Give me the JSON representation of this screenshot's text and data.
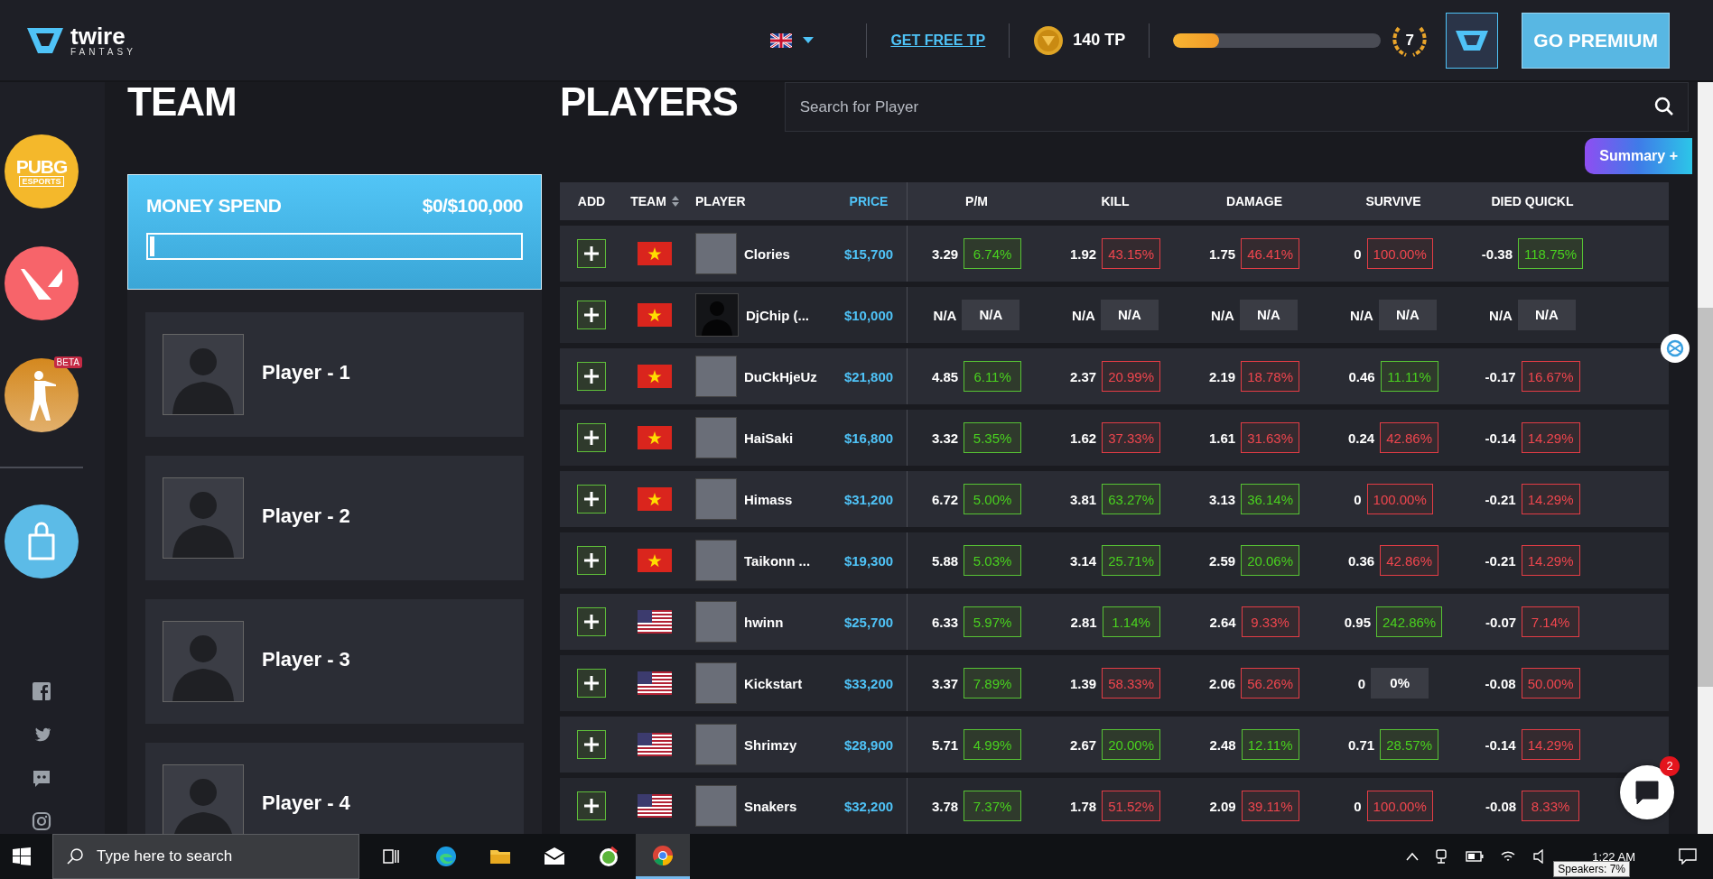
{
  "header": {
    "logo": {
      "name": "twire",
      "sub": "FANTASY"
    },
    "language": {
      "kind": "uk"
    },
    "free_tp_link": "GET FREE TP",
    "balance": "140 TP",
    "xp": {
      "level": 0.22
    },
    "rank": "7",
    "premium_button": "GO PREMIUM"
  },
  "rail": {
    "games": [
      {
        "kind": "pubg",
        "line1": "PUBG",
        "line2": "ESPORTS",
        "selected": false
      },
      {
        "kind": "valorant",
        "selected": false
      },
      {
        "kind": "cs",
        "badge": "BETA",
        "selected": false
      }
    ],
    "social": [
      {
        "kind": "facebook"
      },
      {
        "kind": "twitter"
      },
      {
        "kind": "discord"
      },
      {
        "kind": "instagram"
      }
    ]
  },
  "team": {
    "title": "TEAM",
    "money": {
      "label": "MONEY SPEND",
      "value": "$0/$100,000",
      "level": 0.01
    },
    "slots": [
      "Player - 1",
      "Player - 2",
      "Player - 3",
      "Player - 4"
    ]
  },
  "players": {
    "title": "PLAYERS",
    "search": {
      "placeholder": "Search for Player"
    },
    "summary_button": "Summary +",
    "columns": [
      {
        "label": "ADD",
        "sortable": false,
        "active": false
      },
      {
        "label": "TEAM",
        "sortable": true,
        "active": false
      },
      {
        "label": "PLAYER",
        "sortable": false,
        "active": false
      },
      {
        "label": "PRICE",
        "sortable": false,
        "active": true
      },
      {
        "label": "P/M",
        "sortable": false,
        "active": false
      },
      {
        "label": "KILL",
        "sortable": false,
        "active": false
      },
      {
        "label": "DAMAGE",
        "sortable": false,
        "active": false
      },
      {
        "label": "SURVIVE",
        "sortable": false,
        "active": false
      },
      {
        "label": "DIED QUICKL",
        "sortable": false,
        "active": false
      }
    ],
    "rows": [
      {
        "flag": {
          "kind": "vn"
        },
        "avatar": {
          "kind": "photo"
        },
        "name": "Clories",
        "price": "$15,700",
        "stats": [
          {
            "value": "3.29",
            "pct": "6.74%",
            "kind": "good"
          },
          {
            "value": "1.92",
            "pct": "43.15%",
            "kind": "bad"
          },
          {
            "value": "1.75",
            "pct": "46.41%",
            "kind": "bad"
          },
          {
            "value": "0",
            "pct": "100.00%",
            "kind": "bad"
          },
          {
            "value": "-0.38",
            "pct": "118.75%",
            "kind": "good"
          }
        ]
      },
      {
        "flag": {
          "kind": "vn"
        },
        "avatar": {
          "kind": "silhouette"
        },
        "name": "DjChip (...",
        "price": "$10,000",
        "stats": [
          {
            "value": "N/A",
            "pct": "N/A",
            "kind": "none"
          },
          {
            "value": "N/A",
            "pct": "N/A",
            "kind": "none"
          },
          {
            "value": "N/A",
            "pct": "N/A",
            "kind": "none"
          },
          {
            "value": "N/A",
            "pct": "N/A",
            "kind": "none"
          },
          {
            "value": "N/A",
            "pct": "N/A",
            "kind": "none"
          }
        ]
      },
      {
        "flag": {
          "kind": "vn"
        },
        "avatar": {
          "kind": "photo"
        },
        "name": "DuCkHjeUz",
        "price": "$21,800",
        "stats": [
          {
            "value": "4.85",
            "pct": "6.11%",
            "kind": "good"
          },
          {
            "value": "2.37",
            "pct": "20.99%",
            "kind": "bad"
          },
          {
            "value": "2.19",
            "pct": "18.78%",
            "kind": "bad"
          },
          {
            "value": "0.46",
            "pct": "11.11%",
            "kind": "good"
          },
          {
            "value": "-0.17",
            "pct": "16.67%",
            "kind": "bad"
          }
        ]
      },
      {
        "flag": {
          "kind": "vn"
        },
        "avatar": {
          "kind": "photo"
        },
        "name": "HaiSaki",
        "price": "$16,800",
        "stats": [
          {
            "value": "3.32",
            "pct": "5.35%",
            "kind": "good"
          },
          {
            "value": "1.62",
            "pct": "37.33%",
            "kind": "bad"
          },
          {
            "value": "1.61",
            "pct": "31.63%",
            "kind": "bad"
          },
          {
            "value": "0.24",
            "pct": "42.86%",
            "kind": "bad"
          },
          {
            "value": "-0.14",
            "pct": "14.29%",
            "kind": "bad"
          }
        ]
      },
      {
        "flag": {
          "kind": "vn"
        },
        "avatar": {
          "kind": "photo"
        },
        "name": "Himass",
        "price": "$31,200",
        "stats": [
          {
            "value": "6.72",
            "pct": "5.00%",
            "kind": "good"
          },
          {
            "value": "3.81",
            "pct": "63.27%",
            "kind": "good"
          },
          {
            "value": "3.13",
            "pct": "36.14%",
            "kind": "good"
          },
          {
            "value": "0",
            "pct": "100.00%",
            "kind": "bad"
          },
          {
            "value": "-0.21",
            "pct": "14.29%",
            "kind": "bad"
          }
        ]
      },
      {
        "flag": {
          "kind": "vn"
        },
        "avatar": {
          "kind": "photo"
        },
        "name": "Taikonn ...",
        "price": "$19,300",
        "stats": [
          {
            "value": "5.88",
            "pct": "5.03%",
            "kind": "good"
          },
          {
            "value": "3.14",
            "pct": "25.71%",
            "kind": "good"
          },
          {
            "value": "2.59",
            "pct": "20.06%",
            "kind": "good"
          },
          {
            "value": "0.36",
            "pct": "42.86%",
            "kind": "bad"
          },
          {
            "value": "-0.21",
            "pct": "14.29%",
            "kind": "bad"
          }
        ]
      },
      {
        "flag": {
          "kind": "us"
        },
        "avatar": {
          "kind": "photo"
        },
        "name": "hwinn",
        "price": "$25,700",
        "stats": [
          {
            "value": "6.33",
            "pct": "5.97%",
            "kind": "good"
          },
          {
            "value": "2.81",
            "pct": "1.14%",
            "kind": "good"
          },
          {
            "value": "2.64",
            "pct": "9.33%",
            "kind": "bad"
          },
          {
            "value": "0.95",
            "pct": "242.86%",
            "kind": "good"
          },
          {
            "value": "-0.07",
            "pct": "7.14%",
            "kind": "bad"
          }
        ]
      },
      {
        "flag": {
          "kind": "us"
        },
        "avatar": {
          "kind": "photo"
        },
        "name": "Kickstart",
        "price": "$33,200",
        "stats": [
          {
            "value": "3.37",
            "pct": "7.89%",
            "kind": "good"
          },
          {
            "value": "1.39",
            "pct": "58.33%",
            "kind": "bad"
          },
          {
            "value": "2.06",
            "pct": "56.26%",
            "kind": "bad"
          },
          {
            "value": "0",
            "pct": "0%",
            "kind": "none"
          },
          {
            "value": "-0.08",
            "pct": "50.00%",
            "kind": "bad"
          }
        ]
      },
      {
        "flag": {
          "kind": "us"
        },
        "avatar": {
          "kind": "photo"
        },
        "name": "Shrimzy",
        "price": "$28,900",
        "stats": [
          {
            "value": "5.71",
            "pct": "4.99%",
            "kind": "good"
          },
          {
            "value": "2.67",
            "pct": "20.00%",
            "kind": "good"
          },
          {
            "value": "2.48",
            "pct": "12.11%",
            "kind": "good"
          },
          {
            "value": "0.71",
            "pct": "28.57%",
            "kind": "good"
          },
          {
            "value": "-0.14",
            "pct": "14.29%",
            "kind": "bad"
          }
        ]
      },
      {
        "flag": {
          "kind": "us"
        },
        "avatar": {
          "kind": "photo"
        },
        "name": "Snakers",
        "price": "$32,200",
        "stats": [
          {
            "value": "3.78",
            "pct": "7.37%",
            "kind": "good"
          },
          {
            "value": "1.78",
            "pct": "51.52%",
            "kind": "bad"
          },
          {
            "value": "2.09",
            "pct": "39.11%",
            "kind": "bad"
          },
          {
            "value": "0",
            "pct": "100.00%",
            "kind": "bad"
          },
          {
            "value": "-0.08",
            "pct": "8.33%",
            "kind": "bad"
          }
        ]
      }
    ]
  },
  "chat": {
    "badge": "2"
  },
  "taskbar": {
    "search": {
      "placeholder": "Type here to search"
    },
    "apps": [
      {
        "kind": "taskview",
        "selected": false
      },
      {
        "kind": "edge",
        "selected": false
      },
      {
        "kind": "folder",
        "selected": false
      },
      {
        "kind": "mail",
        "selected": false
      },
      {
        "kind": "ring",
        "selected": false
      },
      {
        "kind": "chrome",
        "selected": true
      }
    ],
    "time": "1:22 AM",
    "tooltip": "Speakers: 7%"
  }
}
